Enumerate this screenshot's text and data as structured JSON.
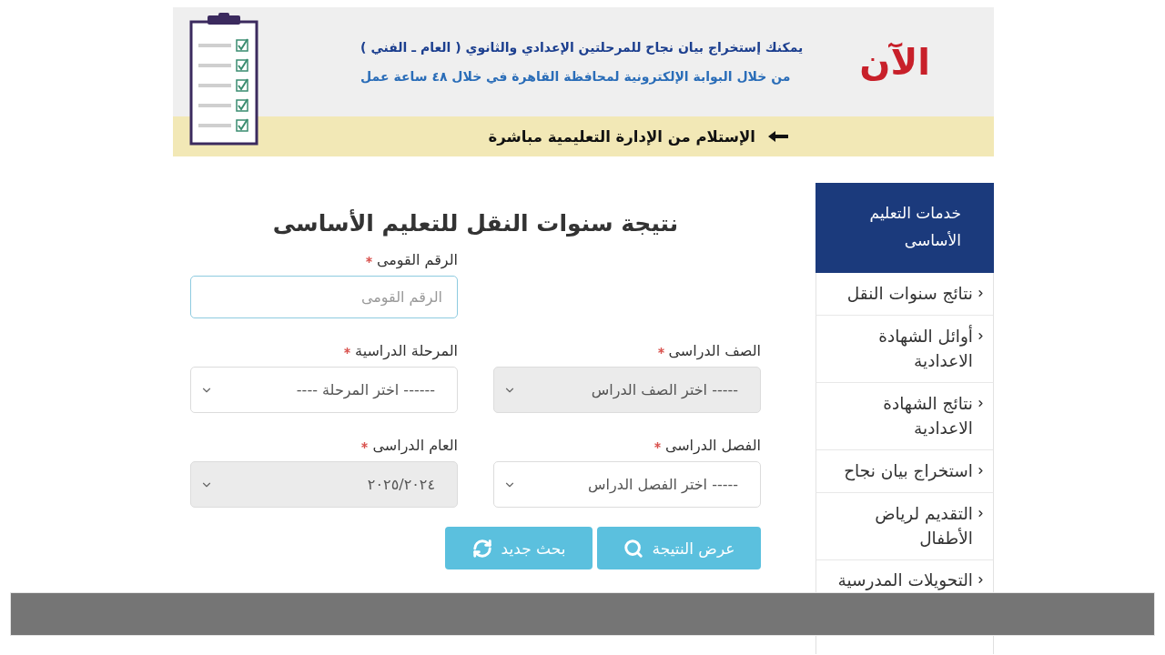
{
  "banner": {
    "badge": "الآن",
    "lines": [
      "يمكنك إستخراج بيان نجاح للمرحلتين الإعدادي والثانوي ( العام ـ الفني )",
      "من خلال البوابة الإلكترونية لمحافظة القاهرة في خلال ٤٨ ساعة عمل"
    ],
    "note": "الإستلام من الإدارة التعليمية مباشرة"
  },
  "form": {
    "title": "نتيجة سنوات النقل للتعليم الأساسى",
    "fields": [
      {
        "kind": "input",
        "label": "الرقم القومى",
        "required": true,
        "placeholder": "الرقم القومى",
        "focused": true,
        "disabled": false
      },
      {
        "kind": "select",
        "label": "الصف الدراسى",
        "required": true,
        "value": "----- اختر الصف الدراس",
        "focused": false,
        "disabled": true
      },
      {
        "kind": "select",
        "label": "المرحلة الدراسية",
        "required": true,
        "value": "------ اختر المرحلة ----",
        "focused": false,
        "disabled": false
      },
      {
        "kind": "select",
        "label": "الفصل الدراسى",
        "required": true,
        "value": "----- اختر الفصل الدراس",
        "focused": false,
        "disabled": false
      },
      {
        "kind": "select",
        "label": "العام الدراسى",
        "required": true,
        "value": "٢٠٢٥/٢٠٢٤",
        "focused": false,
        "disabled": true
      }
    ],
    "buttons": [
      {
        "kind": "submit",
        "label": "عرض النتيجة"
      },
      {
        "kind": "reset",
        "label": "بحث جديد"
      }
    ]
  },
  "sidebar": {
    "title": "خدمات التعليم الأساسى",
    "items": [
      "نتائج سنوات النقل",
      "أوائل الشهادة الاعدادية",
      "نتائج الشهادة الاعدادية",
      "استخراج بيان نجاح",
      "التقديم لرياض الأطفال",
      "التحويلات المدرسية"
    ]
  }
}
